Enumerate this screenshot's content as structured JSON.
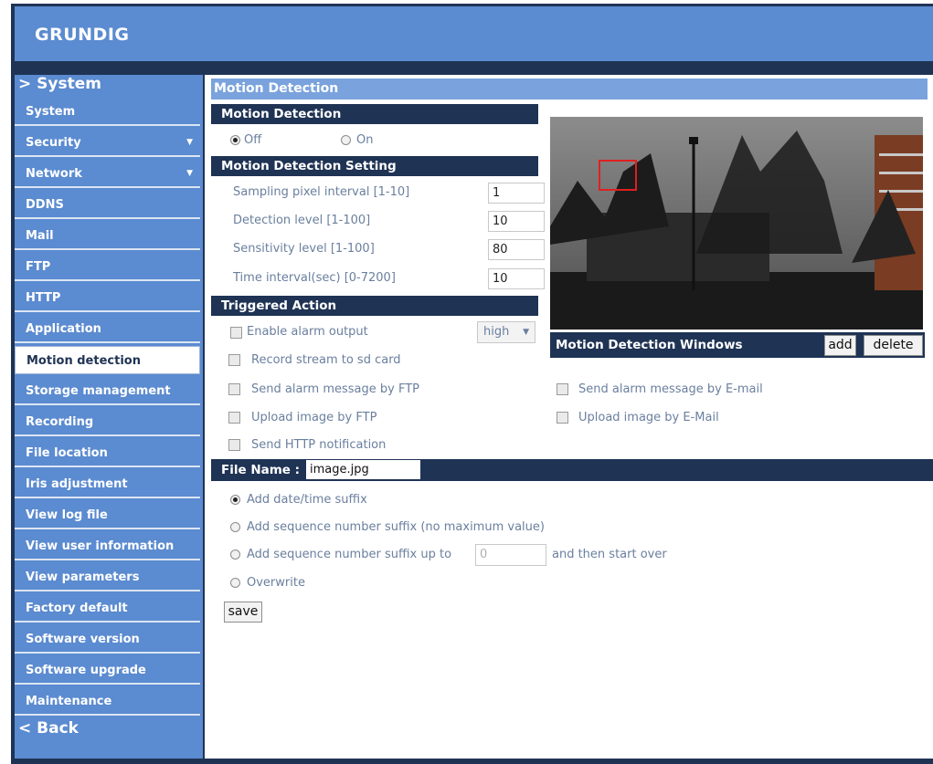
{
  "brand": "GRUNDIG",
  "sidebar": {
    "heading": "> System",
    "items": [
      {
        "label": "System"
      },
      {
        "label": "Security",
        "caret": "▼"
      },
      {
        "label": "Network",
        "caret": "▼"
      },
      {
        "label": "DDNS"
      },
      {
        "label": "Mail"
      },
      {
        "label": "FTP"
      },
      {
        "label": "HTTP"
      },
      {
        "label": "Application"
      },
      {
        "label": "Motion detection"
      },
      {
        "label": "Storage management"
      },
      {
        "label": "Recording"
      },
      {
        "label": "File location"
      },
      {
        "label": "Iris adjustment"
      },
      {
        "label": "View log file"
      },
      {
        "label": "View user information"
      },
      {
        "label": "View parameters"
      },
      {
        "label": "Factory default"
      },
      {
        "label": "Software version"
      },
      {
        "label": "Software upgrade"
      },
      {
        "label": "Maintenance"
      }
    ],
    "back": "< Back"
  },
  "page_title": "Motion Detection",
  "motion": {
    "section": "Motion Detection",
    "off_label": "Off",
    "on_label": "On"
  },
  "setting": {
    "section": "Motion Detection Setting",
    "rows": [
      {
        "label": "Sampling pixel interval [1-10]",
        "value": "1"
      },
      {
        "label": "Detection level [1-100]",
        "value": "10"
      },
      {
        "label": "Sensitivity level [1-100]",
        "value": "80"
      },
      {
        "label": "Time interval(sec) [0-7200]",
        "value": "10"
      }
    ]
  },
  "triggered": {
    "section": "Triggered Action",
    "enable_alarm": "Enable alarm output",
    "alarm_level": "high",
    "record_sd": "Record stream to sd card",
    "ftp_msg": "Send alarm message by FTP",
    "email_msg": "Send alarm message by E-mail",
    "ftp_upload": "Upload image by FTP",
    "email_upload": "Upload image by E-Mail",
    "http_notify": "Send HTTP notification"
  },
  "windows": {
    "label": "Motion Detection Windows",
    "add": "add",
    "delete": "delete"
  },
  "file": {
    "label": "File Name :",
    "value": "image.jpg",
    "opt_datetime": "Add date/time suffix",
    "opt_sequence": "Add sequence number suffix (no maximum value)",
    "opt_upto": "Add sequence number suffix up to",
    "upto_placeholder": "0",
    "opt_upto_after": "and then start over",
    "opt_overwrite": "Overwrite"
  },
  "save": "save",
  "colors": {
    "header": "#5b8bd0",
    "section_bar": "#1f3354",
    "title_bar": "#7aa3dd",
    "motion_window": "#e02020"
  }
}
